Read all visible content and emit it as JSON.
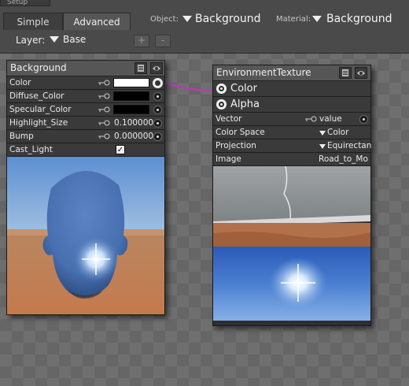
{
  "top": {
    "setup_tab": "Setup",
    "tabs": [
      "Simple",
      "Advanced"
    ],
    "object_label": "Object:",
    "object_value": "Background",
    "material_label": "Material:",
    "material_value": "Background",
    "layer_label": "Layer:",
    "layer_value": "Base",
    "add_button": "+",
    "remove_button": "-"
  },
  "background_node": {
    "title": "Background",
    "rows": [
      {
        "label": "Color",
        "value": "",
        "swatch": "#ffffff",
        "connected": true
      },
      {
        "label": "Diffuse_Color",
        "value": "",
        "swatch": "#000000"
      },
      {
        "label": "Specular_Color",
        "value": "",
        "swatch": "#000000"
      },
      {
        "label": "Highlight_Size",
        "value": "0.100000"
      },
      {
        "label": "Bump",
        "value": "0.000000"
      },
      {
        "label": "Cast_Light",
        "checked": true
      }
    ]
  },
  "env_node": {
    "title": "EnvironmentTexture",
    "outputs": [
      "Color",
      "Alpha"
    ],
    "rows": [
      {
        "label": "Vector",
        "value": "value"
      },
      {
        "label": "Color Space",
        "value": "Color"
      },
      {
        "label": "Projection",
        "value": "Equirectan"
      },
      {
        "label": "Image",
        "value": "Road_to_Mo"
      }
    ]
  },
  "colors": {
    "connection_wire": "#b040b0",
    "swatch_white": "#ffffff",
    "swatch_black": "#000000"
  },
  "icons": [
    "list-icon",
    "eye-icon",
    "key-icon",
    "plug-icon",
    "dropdown-triangle-icon",
    "checkmark-icon"
  ]
}
